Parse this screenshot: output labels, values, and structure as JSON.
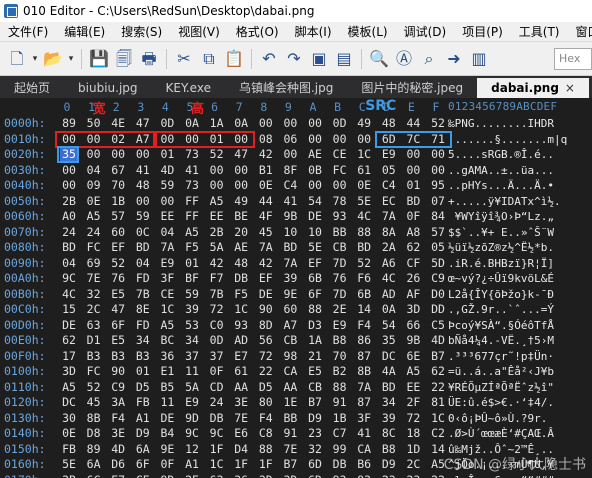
{
  "title": "010 Editor - C:\\Users\\RedSun\\Desktop\\dabai.png",
  "menu": [
    "文件(F)",
    "编辑(E)",
    "搜索(S)",
    "视图(V)",
    "格式(O)",
    "脚本(I)",
    "模板(L)",
    "调试(D)",
    "项目(P)",
    "工具(T)",
    "窗口(W"
  ],
  "toolbar": {
    "icons": [
      "new-file-icon",
      "dropdown-icon",
      "open-folder-icon",
      "dropdown-icon",
      "save-icon",
      "save-all-icon",
      "print-icon",
      "cut-icon",
      "copy-icon",
      "paste-icon",
      "undo-icon",
      "redo-icon",
      "copy-alt-icon",
      "paste-alt-icon",
      "find-icon",
      "replace-icon",
      "find-in-files-icon",
      "goto-icon",
      "toggle-icon"
    ],
    "hex_box": "Hex"
  },
  "tabs": [
    {
      "label": "起始页",
      "active": false
    },
    {
      "label": "biubiu.jpg",
      "active": false
    },
    {
      "label": "KEY.exe",
      "active": false
    },
    {
      "label": "乌镇峰会种图.jpg",
      "active": false
    },
    {
      "label": "图片中的秘密.jpeg",
      "active": false
    },
    {
      "label": "dabai.png",
      "active": true
    }
  ],
  "hex": {
    "col_headers": [
      "0",
      "1",
      "2",
      "3",
      "4",
      "5",
      "6",
      "7",
      "8",
      "9",
      "A",
      "B",
      "C",
      "D",
      "E",
      "F"
    ],
    "ascii_header": "0123456789ABCDEF",
    "rows": [
      {
        "offset": "0000h:",
        "bytes": [
          "89",
          "50",
          "4E",
          "47",
          "0D",
          "0A",
          "1A",
          "0A",
          "00",
          "00",
          "00",
          "0D",
          "49",
          "48",
          "44",
          "52"
        ],
        "ascii": "‰PNG........IHDR"
      },
      {
        "offset": "0010h:",
        "bytes": [
          "00",
          "00",
          "02",
          "A7",
          "00",
          "00",
          "01",
          "00",
          "08",
          "06",
          "00",
          "00",
          "00",
          "6D",
          "7C",
          "71"
        ],
        "ascii": ".......§.......m|q"
      },
      {
        "offset": "0020h:",
        "bytes": [
          "35",
          "00",
          "00",
          "00",
          "01",
          "73",
          "52",
          "47",
          "42",
          "00",
          "AE",
          "CE",
          "1C",
          "E9",
          "00",
          "00"
        ],
        "ascii": "5....sRGB.®Î.é.."
      },
      {
        "offset": "0030h:",
        "bytes": [
          "00",
          "04",
          "67",
          "41",
          "4D",
          "41",
          "00",
          "00",
          "B1",
          "8F",
          "0B",
          "FC",
          "61",
          "05",
          "00",
          "00"
        ],
        "ascii": "..gAMA..±..üa..."
      },
      {
        "offset": "0040h:",
        "bytes": [
          "00",
          "09",
          "70",
          "48",
          "59",
          "73",
          "00",
          "00",
          "0E",
          "C4",
          "00",
          "00",
          "0E",
          "C4",
          "01",
          "95"
        ],
        "ascii": "..pHYs...Ä...Ä.•"
      },
      {
        "offset": "0050h:",
        "bytes": [
          "2B",
          "0E",
          "1B",
          "00",
          "00",
          "FF",
          "A5",
          "49",
          "44",
          "41",
          "54",
          "78",
          "5E",
          "EC",
          "BD",
          "07"
        ],
        "ascii": "+.....ÿ¥IDATx^ì½."
      },
      {
        "offset": "0060h:",
        "bytes": [
          "A0",
          "A5",
          "57",
          "59",
          "EE",
          "FF",
          "EE",
          "BE",
          "4F",
          "9B",
          "DE",
          "93",
          "4C",
          "7A",
          "0F",
          "84"
        ],
        "ascii": " ¥WYîÿî¾O›Þ“Lz.„"
      },
      {
        "offset": "0070h:",
        "bytes": [
          "24",
          "24",
          "60",
          "0C",
          "04",
          "A5",
          "2B",
          "20",
          "45",
          "10",
          "10",
          "BB",
          "88",
          "8A",
          "A8",
          "57"
        ],
        "ascii": "$$`..¥+ E..»ˆŠ¨W"
      },
      {
        "offset": "0080h:",
        "bytes": [
          "BD",
          "FC",
          "EF",
          "BD",
          "7A",
          "F5",
          "5A",
          "AE",
          "7A",
          "BD",
          "5E",
          "CB",
          "BD",
          "2A",
          "62",
          "05"
        ],
        "ascii": "½üï½zõZ®z½^Ë½*b."
      },
      {
        "offset": "0090h:",
        "bytes": [
          "04",
          "69",
          "52",
          "04",
          "E9",
          "01",
          "42",
          "48",
          "42",
          "7A",
          "EF",
          "7D",
          "52",
          "A6",
          "CF",
          "5D"
        ],
        "ascii": ".iR.é.BHBzï}R¦Ï]"
      },
      {
        "offset": "00A0h:",
        "bytes": [
          "9C",
          "7E",
          "76",
          "FD",
          "3F",
          "BF",
          "F7",
          "DB",
          "EF",
          "39",
          "6B",
          "76",
          "F6",
          "4C",
          "26",
          "C9"
        ],
        "ascii": "œ~vý?¿÷Ûï9kvöL&É"
      },
      {
        "offset": "00B0h:",
        "bytes": [
          "4C",
          "32",
          "E5",
          "7B",
          "CE",
          "59",
          "7B",
          "F5",
          "DE",
          "9E",
          "6F",
          "7D",
          "6B",
          "AD",
          "AF",
          "D0"
        ],
        "ascii": "L2å{ÎY{õÞžo}k-¯Ð"
      },
      {
        "offset": "00C0h:",
        "bytes": [
          "15",
          "2C",
          "47",
          "8E",
          "1C",
          "39",
          "72",
          "1C",
          "90",
          "60",
          "88",
          "2E",
          "14",
          "0A",
          "3D",
          "DD"
        ],
        "ascii": ".,GŽ.9r..`ˆ...=Ý"
      },
      {
        "offset": "00D0h:",
        "bytes": [
          "DE",
          "63",
          "6F",
          "FD",
          "A5",
          "53",
          "C0",
          "93",
          "8D",
          "A7",
          "D3",
          "E9",
          "F4",
          "54",
          "66",
          "C5"
        ],
        "ascii": "Þcoý¥SÀ“.§ÓéôTfÅ"
      },
      {
        "offset": "00E0h:",
        "bytes": [
          "62",
          "D1",
          "E5",
          "34",
          "BC",
          "34",
          "0D",
          "AD",
          "56",
          "CB",
          "1A",
          "B8",
          "86",
          "35",
          "9B",
          "4D"
        ],
        "ascii": "bÑå4¼4.-VË.¸†5›M"
      },
      {
        "offset": "00F0h:",
        "bytes": [
          "17",
          "B3",
          "B3",
          "B3",
          "36",
          "37",
          "37",
          "E7",
          "72",
          "98",
          "21",
          "70",
          "87",
          "DC",
          "6E",
          "B7"
        ],
        "ascii": ".³³³677çr˜!p‡Ün·"
      },
      {
        "offset": "0100h:",
        "bytes": [
          "3D",
          "FC",
          "90",
          "01",
          "E1",
          "11",
          "0F",
          "61",
          "22",
          "CA",
          "E5",
          "B2",
          "8B",
          "4A",
          "A5",
          "62"
        ],
        "ascii": "=ü..á..a\"Êå²‹J¥b"
      },
      {
        "offset": "0110h:",
        "bytes": [
          "A5",
          "52",
          "C9",
          "D5",
          "B5",
          "5A",
          "CD",
          "AA",
          "D5",
          "AA",
          "CB",
          "88",
          "7A",
          "BD",
          "EE",
          "22"
        ],
        "ascii": "¥RÉÕµZÍªÕªËˆz½î\""
      },
      {
        "offset": "0120h:",
        "bytes": [
          "DC",
          "45",
          "3A",
          "FB",
          "11",
          "E9",
          "24",
          "3E",
          "80",
          "1E",
          "B7",
          "91",
          "87",
          "34",
          "2F",
          "81"
        ],
        "ascii": "ÜE:û.é$>€.·‘‡4/."
      },
      {
        "offset": "0130h:",
        "bytes": [
          "30",
          "8B",
          "F4",
          "A1",
          "DE",
          "9D",
          "DB",
          "7E",
          "F4",
          "BB",
          "D9",
          "1B",
          "3F",
          "39",
          "72",
          "1C"
        ],
        "ascii": "0‹ô¡ÞÛ~ô»Ù.?9r."
      },
      {
        "offset": "0140h:",
        "bytes": [
          "0E",
          "D8",
          "3E",
          "D9",
          "B4",
          "9C",
          "9C",
          "E6",
          "C8",
          "91",
          "23",
          "C7",
          "41",
          "8C",
          "18",
          "C2"
        ],
        "ascii": ".Ø>Ù´œœæÈ‘#ÇAŒ.Â"
      },
      {
        "offset": "0150h:",
        "bytes": [
          "FB",
          "89",
          "4D",
          "6A",
          "9E",
          "12",
          "1F",
          "D4",
          "88",
          "7E",
          "32",
          "99",
          "CA",
          "B8",
          "1D",
          "14"
        ],
        "ascii": "û‰Mjž..Ôˆ~2™Ê¸.."
      },
      {
        "offset": "0160h:",
        "bytes": [
          "5E",
          "6A",
          "D6",
          "6F",
          "0F",
          "A1",
          "1C",
          "1F",
          "1F",
          "B7",
          "6D",
          "DB",
          "B6",
          "D9",
          "2C",
          "A5"
        ],
        "ascii": "^jÖo.¡...·mÛ¶Ù,¥"
      },
      {
        "offset": "0170h:",
        "bytes": [
          "3B",
          "6C",
          "E7",
          "CE",
          "9D",
          "2E",
          "63",
          "36",
          "3D",
          "3D",
          "6D",
          "93",
          "93",
          "23",
          "23",
          "23"
        ],
        "ascii": ";lçÎ..c6==m““###"
      }
    ]
  },
  "annotations": {
    "width_label": "宽",
    "height_label": "高",
    "crc_label": "SRC"
  },
  "watermark": "CSDN @绿小大隐士书"
}
